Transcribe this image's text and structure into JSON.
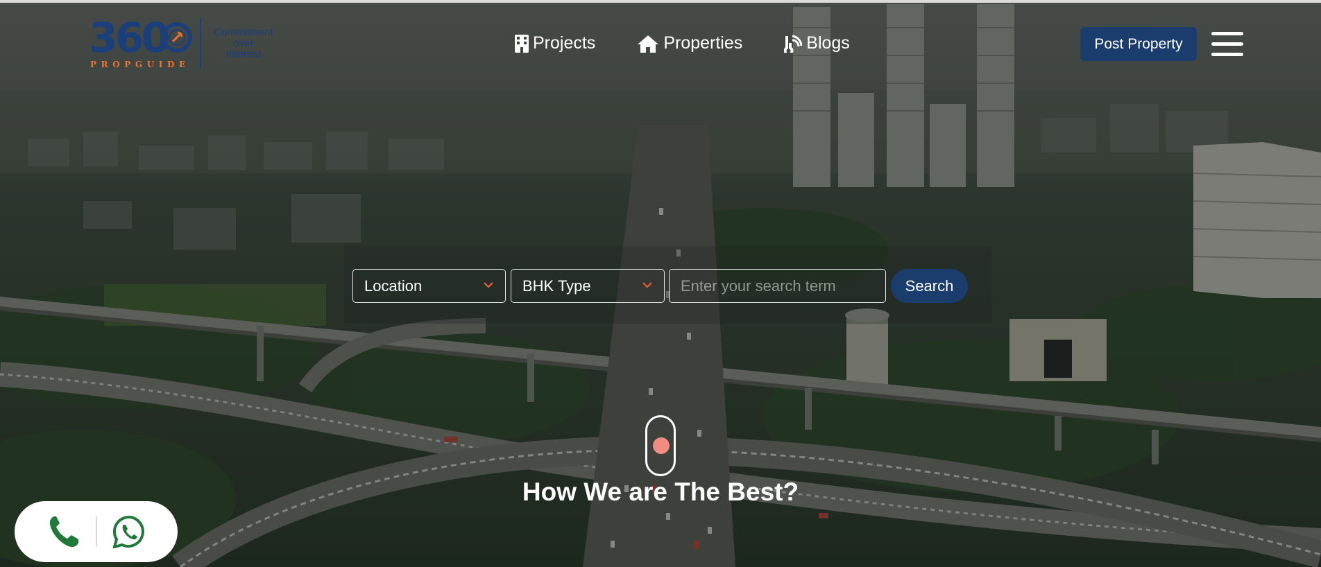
{
  "header": {
    "logo": {
      "number": "360",
      "subtitle": "PROPGUIDE",
      "tagline_line1": "Commitment",
      "tagline_line2": "over",
      "tagline_line3": "Interest"
    },
    "nav": [
      {
        "label": "Projects",
        "icon": "building-icon"
      },
      {
        "label": "Properties",
        "icon": "house-icon"
      },
      {
        "label": "Blogs",
        "icon": "blog-icon"
      }
    ],
    "post_property_label": "Post Property",
    "menu_icon": "hamburger-menu-icon"
  },
  "search": {
    "location_label": "Location",
    "bhk_label": "BHK Type",
    "input_placeholder": "Enter your search term",
    "button_label": "Search"
  },
  "hero": {
    "heading": "How We are The Best?",
    "scroll_icon": "scroll-indicator-icon"
  },
  "contact": {
    "call_icon": "phone-icon",
    "whatsapp_icon": "whatsapp-icon"
  },
  "colors": {
    "brand_blue": "#1b3d6e",
    "brand_orange": "#e8762c",
    "accent_pink": "#f28b82",
    "whatsapp_green": "#1f7a3a"
  }
}
